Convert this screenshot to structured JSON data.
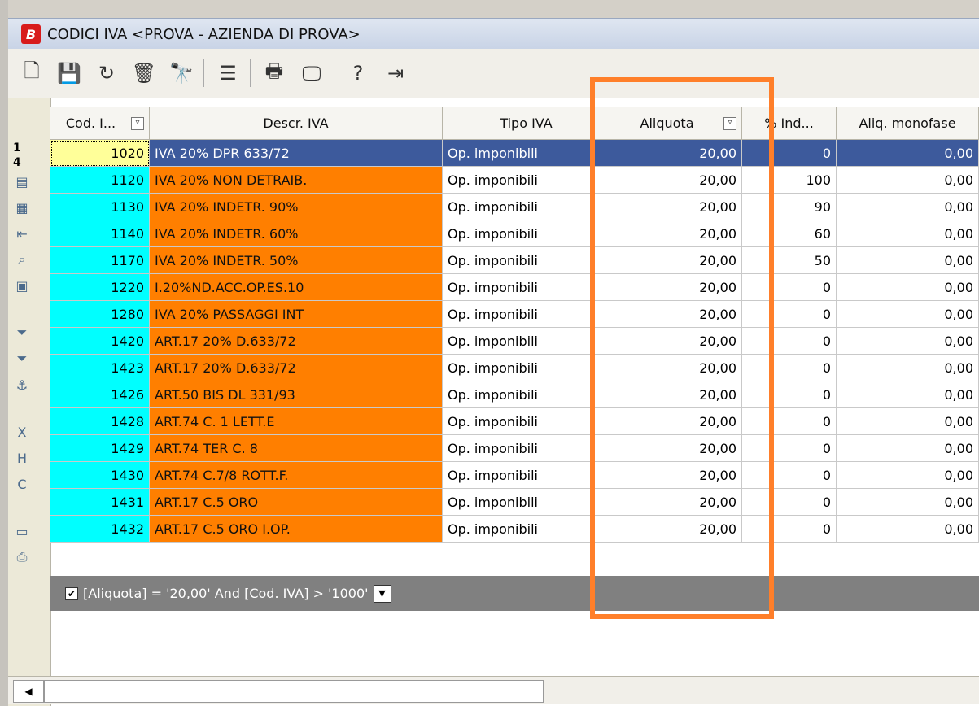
{
  "window": {
    "title": "CODICI IVA <PROVA - AZIENDA DI PROVA>",
    "app_badge": "B"
  },
  "toolbar": {
    "buttons": [
      {
        "name": "new-document-icon",
        "glyph": "🗋"
      },
      {
        "name": "save-icon",
        "glyph": "💾"
      },
      {
        "name": "refresh-icon",
        "glyph": "↻"
      },
      {
        "name": "delete-trash-icon",
        "glyph": "🗑"
      },
      {
        "name": "binoculars-icon",
        "glyph": "🔭"
      },
      {
        "name": "list-view-icon",
        "glyph": "☰"
      },
      {
        "name": "printer-icon",
        "glyph": "🖶"
      },
      {
        "name": "monitor-icon",
        "glyph": "🖵"
      },
      {
        "name": "help-icon",
        "glyph": "?"
      },
      {
        "name": "exit-door-icon",
        "glyph": "⇥"
      }
    ]
  },
  "row_header": {
    "record_index": "1",
    "record_total": "4"
  },
  "columns": {
    "cod": "Cod. I...",
    "desc": "Descr. IVA",
    "tipo": "Tipo IVA",
    "aliq": "Aliquota",
    "ind": "% Ind...",
    "mono": "Aliq. monofase"
  },
  "rows": [
    {
      "cod": "1020",
      "desc": "IVA 20% DPR 633/72",
      "tipo": "Op. imponibili",
      "aliq": "20,00",
      "ind": "0",
      "mono": "0,00"
    },
    {
      "cod": "1120",
      "desc": "IVA 20% NON DETRAIB.",
      "tipo": "Op. imponibili",
      "aliq": "20,00",
      "ind": "100",
      "mono": "0,00"
    },
    {
      "cod": "1130",
      "desc": "IVA 20% INDETR. 90%",
      "tipo": "Op. imponibili",
      "aliq": "20,00",
      "ind": "90",
      "mono": "0,00"
    },
    {
      "cod": "1140",
      "desc": "IVA 20% INDETR. 60%",
      "tipo": "Op. imponibili",
      "aliq": "20,00",
      "ind": "60",
      "mono": "0,00"
    },
    {
      "cod": "1170",
      "desc": "IVA 20% INDETR. 50%",
      "tipo": "Op. imponibili",
      "aliq": "20,00",
      "ind": "50",
      "mono": "0,00"
    },
    {
      "cod": "1220",
      "desc": "I.20%ND.ACC.OP.ES.10",
      "tipo": "Op. imponibili",
      "aliq": "20,00",
      "ind": "0",
      "mono": "0,00"
    },
    {
      "cod": "1280",
      "desc": "IVA 20% PASSAGGI INT",
      "tipo": "Op. imponibili",
      "aliq": "20,00",
      "ind": "0",
      "mono": "0,00"
    },
    {
      "cod": "1420",
      "desc": "ART.17 20% D.633/72",
      "tipo": "Op. imponibili",
      "aliq": "20,00",
      "ind": "0",
      "mono": "0,00"
    },
    {
      "cod": "1423",
      "desc": "ART.17 20%  D.633/72",
      "tipo": "Op. imponibili",
      "aliq": "20,00",
      "ind": "0",
      "mono": "0,00"
    },
    {
      "cod": "1426",
      "desc": "ART.50 BIS DL 331/93",
      "tipo": "Op. imponibili",
      "aliq": "20,00",
      "ind": "0",
      "mono": "0,00"
    },
    {
      "cod": "1428",
      "desc": "ART.74 C. 1 LETT.E",
      "tipo": "Op. imponibili",
      "aliq": "20,00",
      "ind": "0",
      "mono": "0,00"
    },
    {
      "cod": "1429",
      "desc": "ART.74 TER C. 8",
      "tipo": "Op. imponibili",
      "aliq": "20,00",
      "ind": "0",
      "mono": "0,00"
    },
    {
      "cod": "1430",
      "desc": "ART.74 C.7/8 ROTT.F.",
      "tipo": "Op. imponibili",
      "aliq": "20,00",
      "ind": "0",
      "mono": "0,00"
    },
    {
      "cod": "1431",
      "desc": "ART.17 C.5 ORO",
      "tipo": "Op. imponibili",
      "aliq": "20,00",
      "ind": "0",
      "mono": "0,00"
    },
    {
      "cod": "1432",
      "desc": "ART.17 C.5 ORO I.OP.",
      "tipo": "Op. imponibili",
      "aliq": "20,00",
      "ind": "0",
      "mono": "0,00"
    }
  ],
  "filter": {
    "expression": "[Aliquota] = '20,00' And [Cod. IVA] > '1000'",
    "enabled_mark": "✔",
    "dropdown_glyph": "▼"
  },
  "scrollbar": {
    "left_arrow": "◀"
  },
  "colors": {
    "code_cell": "#00ffff",
    "desc_cell": "#ff7f00",
    "selected_row": "#3d5a9c",
    "highlight_box": "#ff7f2a"
  }
}
